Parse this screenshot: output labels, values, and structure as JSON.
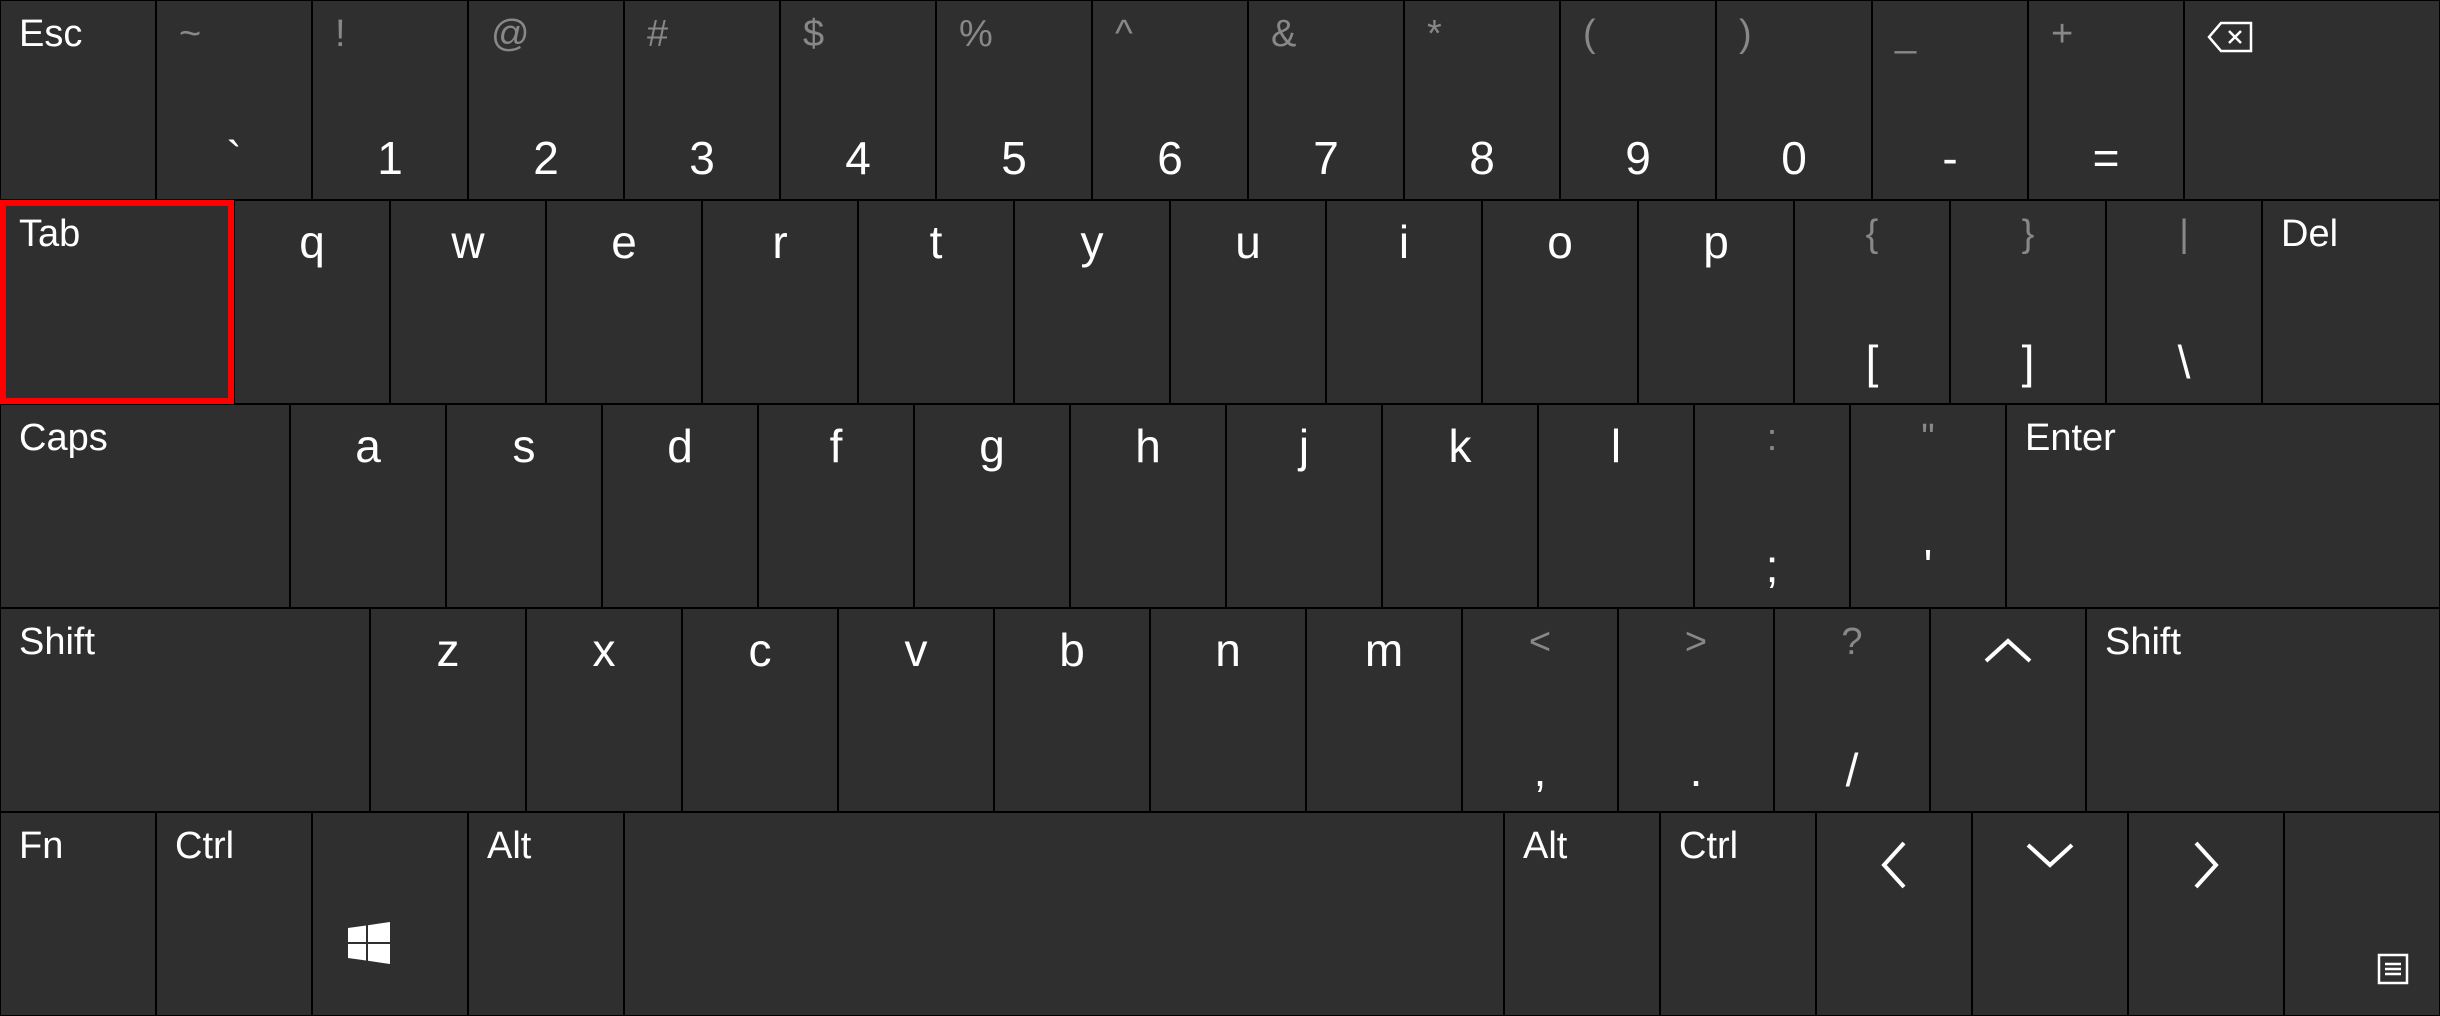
{
  "row1": {
    "esc": "Esc",
    "keys": [
      {
        "sec": "~",
        "prim": "`"
      },
      {
        "sec": "!",
        "prim": "1"
      },
      {
        "sec": "@",
        "prim": "2"
      },
      {
        "sec": "#",
        "prim": "3"
      },
      {
        "sec": "$",
        "prim": "4"
      },
      {
        "sec": "%",
        "prim": "5"
      },
      {
        "sec": "^",
        "prim": "6"
      },
      {
        "sec": "&",
        "prim": "7"
      },
      {
        "sec": "*",
        "prim": "8"
      },
      {
        "sec": "(",
        "prim": "9"
      },
      {
        "sec": ")",
        "prim": "0"
      },
      {
        "sec": "_",
        "prim": "-"
      },
      {
        "sec": "+",
        "prim": "="
      }
    ]
  },
  "row2": {
    "tab": "Tab",
    "letters": [
      "q",
      "w",
      "e",
      "r",
      "t",
      "y",
      "u",
      "i",
      "o",
      "p"
    ],
    "punct": [
      {
        "sec": "{",
        "prim": "["
      },
      {
        "sec": "}",
        "prim": "]"
      },
      {
        "sec": "|",
        "prim": "\\"
      }
    ],
    "del": "Del"
  },
  "row3": {
    "caps": "Caps",
    "letters": [
      "a",
      "s",
      "d",
      "f",
      "g",
      "h",
      "j",
      "k",
      "l"
    ],
    "punct": [
      {
        "sec": ":",
        "prim": ";"
      },
      {
        "sec": "\"",
        "prim": "'"
      }
    ],
    "enter": "Enter"
  },
  "row4": {
    "shiftL": "Shift",
    "letters": [
      "z",
      "x",
      "c",
      "v",
      "b",
      "n",
      "m"
    ],
    "punct": [
      {
        "sec": "<",
        "prim": ","
      },
      {
        "sec": ">",
        "prim": "."
      },
      {
        "sec": "?",
        "prim": "/"
      }
    ],
    "shiftR": "Shift"
  },
  "row5": {
    "fn": "Fn",
    "ctrlL": "Ctrl",
    "altL": "Alt",
    "altR": "Alt",
    "ctrlR": "Ctrl"
  }
}
